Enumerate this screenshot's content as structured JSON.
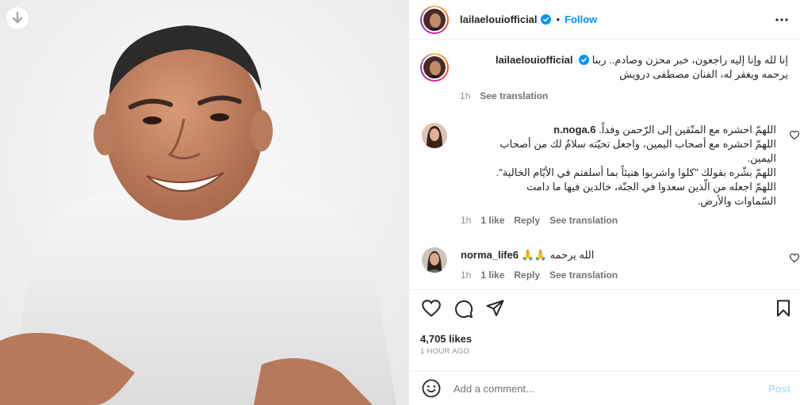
{
  "post": {
    "username": "lailaelouiofficial",
    "follow_label": "Follow",
    "separator": "•",
    "caption_line1": "إنا لله وإنا إليه راجعون، خبر محزن وصادم.. ربنا",
    "caption_line2": "يرحمه ويغفر له، الفنان مصطفى درويش",
    "caption_age": "1h",
    "see_translation": "See translation"
  },
  "comments": [
    {
      "username": "n.noga.6",
      "lines": [
        "اللهمّ احشره مع المتّقين إلى الرّحمن وفداً.",
        "اللهمّ احشره مع أصحاب اليمين، واجعل تحيّته سلامٌ لك من أصحاب",
        "اليمين.",
        "اللهمّ بشّره بقولك \"كلوا واشربوا هنيئاً بما أسلفتم في الأيّام الخالية\".",
        "اللهمّ اجعله من الّذين سعدوا في الجنّة، خالدين فيها ما دامت",
        "السّماوات والأرض."
      ],
      "age": "1h",
      "likes": "1 like",
      "reply": "Reply",
      "see_translation": "See translation"
    },
    {
      "username": "norma_life6",
      "text": "الله يرحمه 🙏🙏",
      "age": "1h",
      "likes": "1 like",
      "reply": "Reply",
      "see_translation": "See translation"
    }
  ],
  "footer": {
    "likes": "4,705 likes",
    "time": "1 HOUR AGO",
    "comment_placeholder": "Add a comment...",
    "post_label": "Post"
  },
  "icons": {
    "download": "download-arrow-icon",
    "verified": "verified-badge-icon",
    "more": "more-options-icon",
    "like": "heart-icon",
    "comment": "comment-icon",
    "share": "share-icon",
    "save": "bookmark-icon",
    "emoji": "emoji-icon"
  },
  "colors": {
    "link_blue": "#0095f6",
    "verified_blue": "#0095f6",
    "post_disabled": "#b2dffc",
    "muted": "#8e8e8e"
  }
}
